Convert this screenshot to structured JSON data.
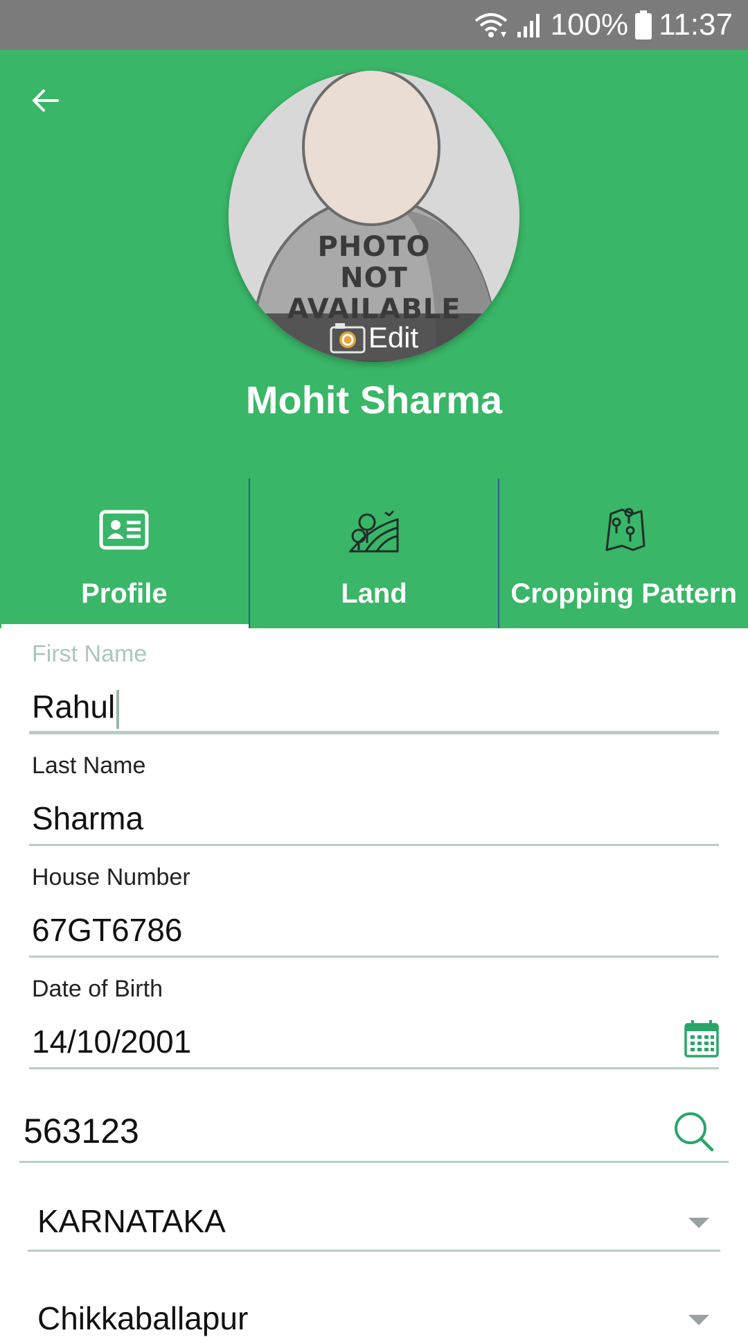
{
  "status_bar": {
    "battery": "100%",
    "time": "11:37"
  },
  "header": {
    "photo_placeholder": [
      "PHOTO",
      "NOT",
      "AVAILABLE"
    ],
    "edit_label": "Edit",
    "user_name": "Mohit Sharma"
  },
  "tabs": [
    {
      "label": "Profile",
      "icon": "id-card-icon",
      "active": true
    },
    {
      "label": "Land",
      "icon": "land-icon",
      "active": false
    },
    {
      "label": "Cropping Pattern",
      "icon": "map-pins-icon",
      "active": false
    }
  ],
  "form": {
    "first_name": {
      "label": "First Name",
      "value": "Rahul"
    },
    "last_name": {
      "label": "Last Name",
      "value": "Sharma"
    },
    "house_number": {
      "label": "House Number",
      "value": "67GT6786"
    },
    "dob": {
      "label": "Date of Birth",
      "value": "14/10/2001"
    },
    "pincode": {
      "value": "563123"
    },
    "state": {
      "value": "KARNATAKA"
    },
    "district": {
      "value": "Chikkaballapur"
    }
  },
  "colors": {
    "primary_green": "#39b667",
    "status_bar": "#7b7b7b",
    "accent_icon": "#2aa56a"
  }
}
